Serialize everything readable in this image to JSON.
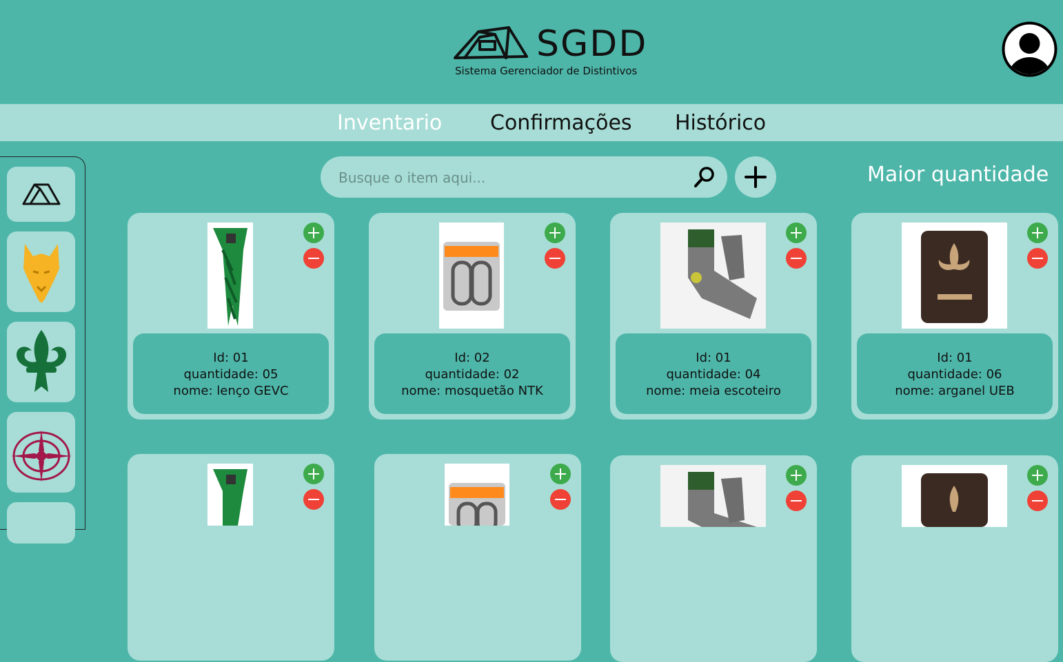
{
  "app": {
    "logo_title": "SGDD",
    "logo_subtitle": "Sistema Gerenciador de Distintivos"
  },
  "nav": {
    "items": [
      {
        "label": "Inventario",
        "active": true
      },
      {
        "label": "Confirmações",
        "active": false
      },
      {
        "label": "Histórico",
        "active": false
      }
    ]
  },
  "sidebar": {
    "icons": [
      "tent-icon",
      "wolf-icon",
      "fleur-de-lis-icon",
      "compass-rose-icon"
    ]
  },
  "search": {
    "placeholder": "Busque o item aqui..."
  },
  "sort": {
    "label": "Maior quantidade"
  },
  "colors": {
    "teal": "#4db6a9",
    "light_teal": "#a7ddd6",
    "plus": "#3daa4c",
    "minus": "#ef4136"
  },
  "cards": [
    {
      "id": "Id: 01",
      "qty": "quantidade: 05",
      "name": "nome: lenço GEVC",
      "image": "scarf-image"
    },
    {
      "id": "Id: 02",
      "qty": "quantidade: 02",
      "name": "nome: mosquetão NTK",
      "image": "carabiner-image"
    },
    {
      "id": "Id: 01",
      "qty": "quantidade: 04",
      "name": "nome: meia escoteiro",
      "image": "socks-image"
    },
    {
      "id": "Id: 01",
      "qty": "quantidade: 06",
      "name": "nome: arganel UEB",
      "image": "woggle-image"
    },
    {
      "image": "scarf-image"
    },
    {
      "image": "carabiner-image"
    },
    {
      "image": "socks-image"
    },
    {
      "image": "woggle-image"
    }
  ]
}
